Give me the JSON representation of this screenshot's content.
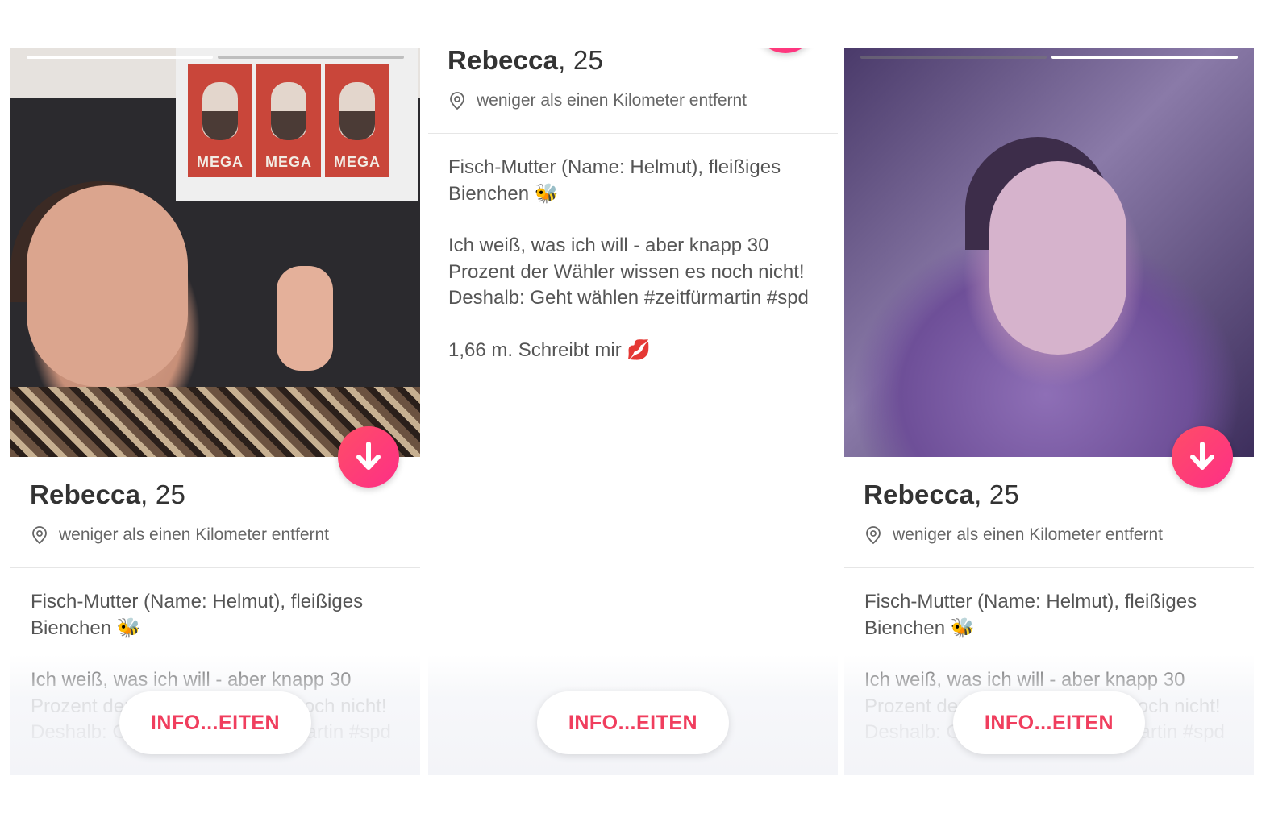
{
  "profile": {
    "name": "Rebecca",
    "age": ", 25",
    "distance": "weniger als einen Kilometer entfernt",
    "bio_paragraphs": [
      "Fisch-Mutter (Name: Helmut), fleißiges Bienchen 🐝",
      "Ich weiß, was ich will - aber knapp 30 Prozent der Wähler wissen es noch nicht! Deshalb: Geht wählen #zeitfürmartin #spd",
      "1,66 m. Schreibt mir 💋"
    ]
  },
  "poster_text": "MEGA",
  "more_info_button": "INFO...EITEN",
  "photo_progress": {
    "panel1": {
      "active_index": 0,
      "count": 2
    },
    "panel3": {
      "active_index": 1,
      "count": 2
    }
  },
  "colors": {
    "accent": "#f03e5e",
    "fab_gradient_start": "#ff4d67",
    "fab_gradient_end": "#fd2f86"
  },
  "icons": {
    "location": "location-pin-icon",
    "collapse": "arrow-down-icon"
  }
}
